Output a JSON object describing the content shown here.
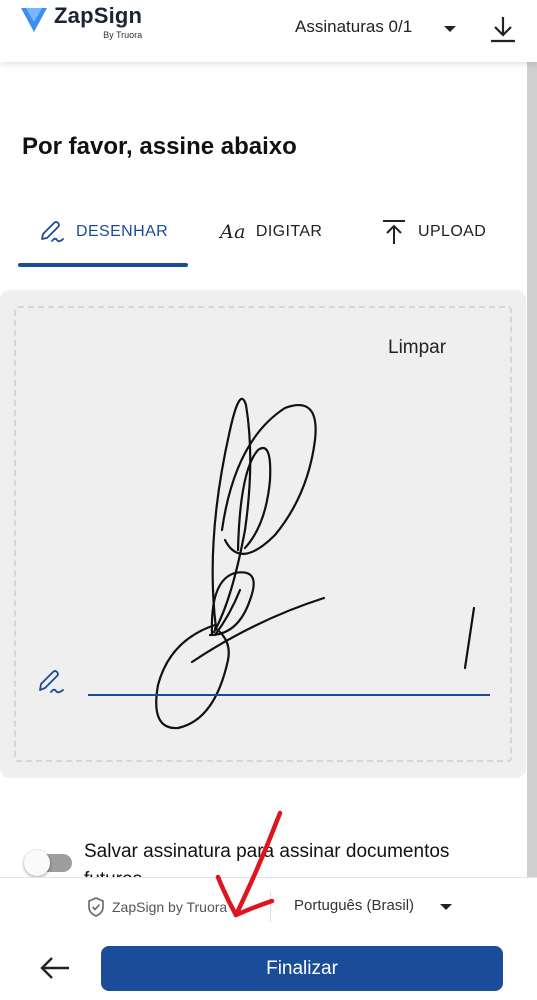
{
  "header": {
    "logo_name": "ZapSign",
    "logo_sub": "By Truora",
    "signatures_label": "Assinaturas 0/1",
    "accent": "#1a4c9a"
  },
  "main": {
    "title": "Por favor, assine abaixo",
    "tabs": [
      {
        "label": "DESENHAR",
        "icon": "pen-icon",
        "active": true
      },
      {
        "label": "DIGITAR",
        "icon": "text-aa-icon",
        "active": false
      },
      {
        "label": "UPLOAD",
        "icon": "upload-icon",
        "active": false
      }
    ],
    "type_icon_text": "Aa",
    "clear_label": "Limpar",
    "save_signature": {
      "label": "Salvar assinatura para assinar documentos futuros",
      "enabled": false
    }
  },
  "footer": {
    "powered_by": "ZapSign by Truora",
    "language": "Português (Brasil)",
    "finish_label": "Finalizar"
  },
  "colors": {
    "primary": "#1a4c9a",
    "pad_background": "#efefef",
    "annotation": "#e0141e"
  }
}
